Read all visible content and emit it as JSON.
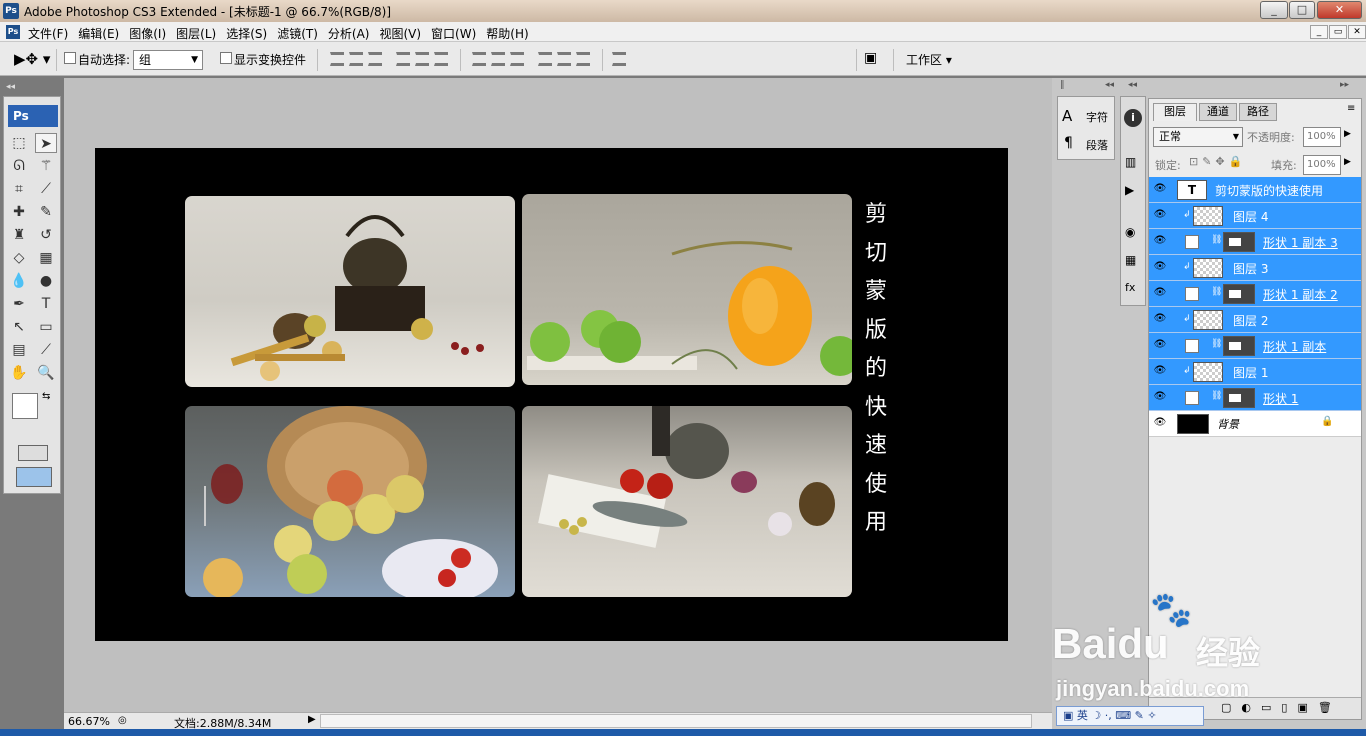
{
  "window": {
    "title": "Adobe Photoshop CS3 Extended - [未标题-1 @ 66.7%(RGB/8)]",
    "app_badge": "Ps",
    "controls": [
      "_",
      "□",
      "✕"
    ]
  },
  "menu": {
    "items": [
      "文件(F)",
      "编辑(E)",
      "图像(I)",
      "图层(L)",
      "选择(S)",
      "滤镜(T)",
      "分析(A)",
      "视图(V)",
      "窗口(W)",
      "帮助(H)"
    ]
  },
  "options": {
    "auto_select_label": "自动选择:",
    "auto_select_value": "组",
    "show_transform_label": "显示变换控件",
    "workspace_label": "工作区"
  },
  "toolbox": {
    "badge": "Ps"
  },
  "document": {
    "vertical_title": [
      "剪",
      "切",
      "蒙",
      "版",
      "的",
      "快",
      "速",
      "使",
      "用"
    ]
  },
  "status": {
    "zoom": "66.67%",
    "doc_size": "文档:2.88M/8.34M"
  },
  "char_panel": {
    "char_label": "字符",
    "para_label": "段落"
  },
  "layers_panel": {
    "tabs": [
      "图层",
      "通道",
      "路径"
    ],
    "blend_mode": "正常",
    "opacity_label": "不透明度:",
    "opacity_value": "100%",
    "lock_label": "锁定:",
    "fill_label": "填充:",
    "fill_value": "100%",
    "layers": [
      {
        "name": "剪切蒙版的快速使用",
        "kind": "text"
      },
      {
        "name": "图层 4",
        "kind": "clipped"
      },
      {
        "name": "形状 1 副本 3",
        "kind": "shape"
      },
      {
        "name": "图层 3",
        "kind": "clipped"
      },
      {
        "name": "形状 1 副本 2",
        "kind": "shape"
      },
      {
        "name": "图层 2",
        "kind": "clipped"
      },
      {
        "name": "形状 1 副本",
        "kind": "shape"
      },
      {
        "name": "图层 1",
        "kind": "clipped"
      },
      {
        "name": "形状 1",
        "kind": "shape"
      },
      {
        "name": "背景",
        "kind": "background"
      }
    ]
  },
  "ime_bar": {
    "lang": "英"
  },
  "watermark": {
    "brand": "Baidu",
    "cn": "经验",
    "url": "jingyan.baidu.com"
  },
  "colors": {
    "selected_layer": "#3399ff",
    "canvas_bg": "#bfbfbf",
    "document_bg": "#000000",
    "title_text": "#ffffff"
  }
}
